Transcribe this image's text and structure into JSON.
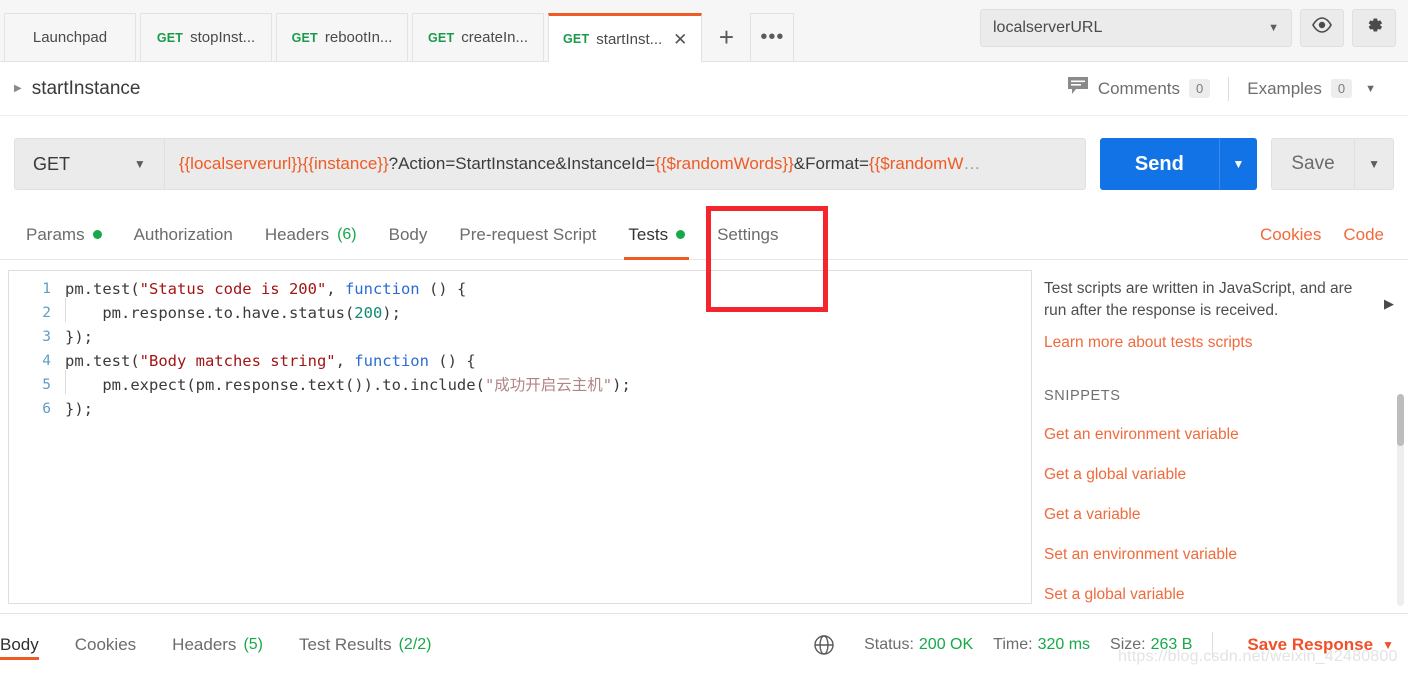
{
  "tabbar": {
    "tabs": [
      {
        "verb": "",
        "name": "Launchpad",
        "active": false
      },
      {
        "verb": "GET",
        "name": "stopInst...",
        "active": false
      },
      {
        "verb": "GET",
        "name": "rebootIn...",
        "active": false
      },
      {
        "verb": "GET",
        "name": "createIn...",
        "active": false
      },
      {
        "verb": "GET",
        "name": "startInst...",
        "active": true
      }
    ],
    "new_tab_label": "+",
    "more_label": "•••",
    "close_label": "✕",
    "environment": "localserverURL",
    "env_caret": "▼",
    "eye_icon": "eye-icon",
    "gear_icon": "gear-icon"
  },
  "breadcrumb": {
    "expand_caret": "▶",
    "title": "startInstance",
    "comments_label": "Comments",
    "comments_count": "0",
    "examples_label": "Examples",
    "examples_count": "0",
    "examples_caret": "▼"
  },
  "url_row": {
    "method": "GET",
    "method_caret": "▼",
    "url_var1": "{{localserverurl}}{{instance}}",
    "url_mid": "?Action=StartInstance&InstanceId=",
    "url_var2": "{{$randomWords}}",
    "url_mid2": "&Format=",
    "url_var3": "{{$randomW",
    "url_ellipsis": "…",
    "send_label": "Send",
    "send_caret": "▼",
    "save_label": "Save",
    "save_caret": "▼"
  },
  "request_tabs": {
    "items": [
      {
        "label": "Params",
        "dot": true,
        "count": "",
        "active": false
      },
      {
        "label": "Authorization",
        "dot": false,
        "count": "",
        "active": false
      },
      {
        "label": "Headers",
        "dot": false,
        "count": "(6)",
        "active": false
      },
      {
        "label": "Body",
        "dot": false,
        "count": "",
        "active": false
      },
      {
        "label": "Pre-request Script",
        "dot": false,
        "count": "",
        "active": false
      },
      {
        "label": "Tests",
        "dot": true,
        "count": "",
        "active": true
      },
      {
        "label": "Settings",
        "dot": false,
        "count": "",
        "active": false
      }
    ],
    "cookies_label": "Cookies",
    "code_label": "Code"
  },
  "editor": {
    "lines": [
      {
        "num": "1",
        "indent": false,
        "parts": [
          {
            "t": "pm.test(",
            "c": ""
          },
          {
            "t": "\"Status code is 200\"",
            "c": "s-str"
          },
          {
            "t": ", ",
            "c": ""
          },
          {
            "t": "function",
            "c": "s-kw"
          },
          {
            "t": " () {",
            "c": ""
          }
        ]
      },
      {
        "num": "2",
        "indent": true,
        "parts": [
          {
            "t": "    pm.response.to.have.status(",
            "c": ""
          },
          {
            "t": "200",
            "c": "s-num"
          },
          {
            "t": ");",
            "c": ""
          }
        ]
      },
      {
        "num": "3",
        "indent": false,
        "parts": [
          {
            "t": "});",
            "c": ""
          }
        ]
      },
      {
        "num": "4",
        "indent": false,
        "parts": [
          {
            "t": "pm.test(",
            "c": ""
          },
          {
            "t": "\"Body matches string\"",
            "c": "s-str"
          },
          {
            "t": ", ",
            "c": ""
          },
          {
            "t": "function",
            "c": "s-kw"
          },
          {
            "t": " () {",
            "c": ""
          }
        ]
      },
      {
        "num": "5",
        "indent": true,
        "parts": [
          {
            "t": "    pm.expect(pm.response.text()).to.include(",
            "c": ""
          },
          {
            "t": "\"成功开启云主机\"",
            "c": "s-cn"
          },
          {
            "t": ");",
            "c": ""
          }
        ]
      },
      {
        "num": "6",
        "indent": false,
        "parts": [
          {
            "t": "});",
            "c": ""
          }
        ]
      }
    ]
  },
  "sidebar": {
    "description": "Test scripts are written in JavaScript, and are run after the response is received.",
    "learn_more": "Learn more about tests scripts",
    "snippets_heading": "SNIPPETS",
    "collapse_arrow": "▶",
    "snippets": [
      "Get an environment variable",
      "Get a global variable",
      "Get a variable",
      "Set an environment variable",
      "Set a global variable"
    ]
  },
  "response": {
    "tabs": [
      {
        "label": "Body",
        "count": "",
        "active": true
      },
      {
        "label": "Cookies",
        "count": "",
        "active": false
      },
      {
        "label": "Headers",
        "count": "(5)",
        "active": false
      },
      {
        "label": "Test Results",
        "count": "(2/2)",
        "active": false
      }
    ],
    "globe_icon": "globe-icon",
    "status_label": "Status:",
    "status_value": "200 OK",
    "time_label": "Time:",
    "time_value": "320 ms",
    "size_label": "Size:",
    "size_value": "263 B",
    "save_response_label": "Save Response",
    "save_response_caret": "▼"
  },
  "watermark": "https://blog.csdn.net/weixin_42480800",
  "colors": {
    "accent_orange": "#ef5b25",
    "send_blue": "#1273e6",
    "success_green": "#17a84a",
    "annotation_red": "#f5252d"
  }
}
